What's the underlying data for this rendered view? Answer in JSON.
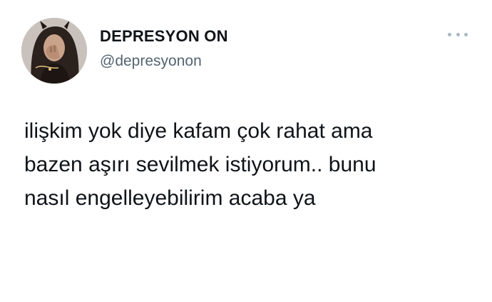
{
  "tweet": {
    "author": {
      "display_name": "DEPRESYON ON",
      "handle": "@depresyonon",
      "avatar_icon": "profile-photo"
    },
    "more_icon": "more-horizontal-icon",
    "text": "ilişkim yok diye kafam çok rahat ama\nbazen aşırı sevilmek istiyorum.. bunu\nnasıl engelleyebilirim acaba ya"
  }
}
